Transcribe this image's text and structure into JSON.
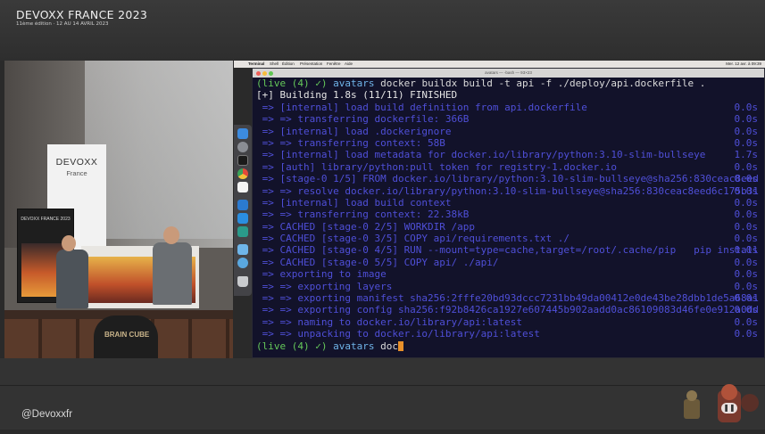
{
  "event": {
    "title": "DEVOXX FRANCE 2023",
    "subtitle": "11ème édition · 12 AU 14 AVRIL 2023"
  },
  "stage": {
    "banner_title": "DEVOXX",
    "banner_sub": "France",
    "screen_title": "DEVOXX FRANCE 2023",
    "audience_shirt": "BRAIN CUBE"
  },
  "mac_menu": {
    "items": [
      "Terminal",
      "Shell",
      "Édition",
      "Présentation",
      "Fenêtre",
      "Aide"
    ],
    "clock": "Mer. 12 avr. à 09:39"
  },
  "terminal": {
    "window_title": "avatars — -bash — 93×23",
    "prompt_live": "(live (4) ✓)",
    "prompt_path": "avatars",
    "command": "docker buildx build -t api -f ./deploy/api.dockerfile .",
    "status": "[+] Building 1.8s (11/11) FINISHED",
    "steps": [
      {
        "text": " => [internal] load build definition from api.dockerfile",
        "time": "0.0s"
      },
      {
        "text": " => => transferring dockerfile: 366B",
        "time": "0.0s"
      },
      {
        "text": " => [internal] load .dockerignore",
        "time": "0.0s"
      },
      {
        "text": " => => transferring context: 58B",
        "time": "0.0s"
      },
      {
        "text": " => [internal] load metadata for docker.io/library/python:3.10-slim-bullseye",
        "time": "1.7s"
      },
      {
        "text": " => [auth] library/python:pull token for registry-1.docker.io",
        "time": "0.0s"
      },
      {
        "text": " => [stage-0 1/5] FROM docker.io/library/python:3.10-slim-bullseye@sha256:830ceac8eed",
        "time": "0.0s"
      },
      {
        "text": " => => resolve docker.io/library/python:3.10-slim-bullseye@sha256:830ceac8eed6c175b31",
        "time": "0.0s"
      },
      {
        "text": " => [internal] load build context",
        "time": "0.0s"
      },
      {
        "text": " => => transferring context: 22.38kB",
        "time": "0.0s"
      },
      {
        "text": " => CACHED [stage-0 2/5] WORKDIR /app",
        "time": "0.0s"
      },
      {
        "text": " => CACHED [stage-0 3/5] COPY api/requirements.txt ./",
        "time": "0.0s"
      },
      {
        "text": " => CACHED [stage-0 4/5] RUN --mount=type=cache,target=/root/.cache/pip   pip install",
        "time": "0.0s"
      },
      {
        "text": " => CACHED [stage-0 5/5] COPY api/ ./api/",
        "time": "0.0s"
      },
      {
        "text": " => exporting to image",
        "time": "0.0s"
      },
      {
        "text": " => => exporting layers",
        "time": "0.0s"
      },
      {
        "text": " => => exporting manifest sha256:2fffe20bd93dccc7231bb49da00412e0de43be28dbb1de5a68a1",
        "time": "0.0s"
      },
      {
        "text": " => => exporting config sha256:f92b8426ca1927e607445b902aadd0ac86109083d46fe0e912a0dd",
        "time": "0.0s"
      },
      {
        "text": " => => naming to docker.io/library/api:latest",
        "time": "0.0s"
      },
      {
        "text": " => => unpacking to docker.io/library/api:latest",
        "time": "0.0s"
      }
    ],
    "typed": "doc"
  },
  "footer": {
    "handle": "@Devoxxfr",
    "pause_icon": "pause-icon"
  },
  "colors": {
    "terminal_bg": "#12122a",
    "step_text": "#4f4fd8",
    "prompt_live": "#65c95a",
    "prompt_path": "#6fb3e8",
    "cursor": "#e8902a"
  }
}
